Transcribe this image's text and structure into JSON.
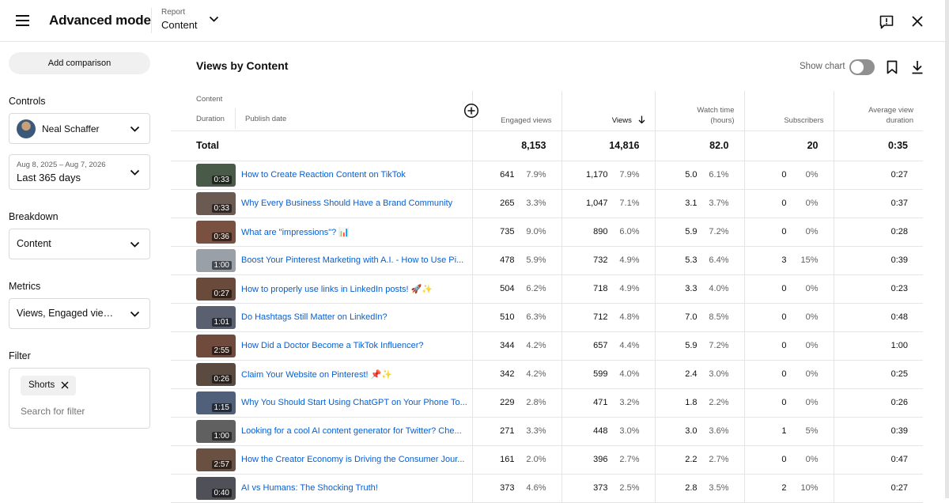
{
  "header": {
    "app_title": "Advanced mode",
    "report_label": "Report",
    "report_value": "Content"
  },
  "sidebar": {
    "add_comparison": "Add comparison",
    "controls_label": "Controls",
    "channel": "Neal Schaffer",
    "date_range_small": "Aug 8, 2025 – Aug 7, 2026",
    "date_range": "Last 365 days",
    "breakdown_label": "Breakdown",
    "breakdown_value": "Content",
    "metrics_label": "Metrics",
    "metrics_value": "Views, Engaged views, Watch time (hours), Subscribers, Average view duration",
    "filter_label": "Filter",
    "filter_chip": "Shorts",
    "filter_placeholder": "Search for filter"
  },
  "main": {
    "title": "Views by Content",
    "show_chart_label": "Show chart"
  },
  "table": {
    "headers": {
      "content": "Content",
      "duration": "Duration",
      "publish_date": "Publish date",
      "engaged_views": "Engaged views",
      "views": "Views",
      "watch_time_1": "Watch time",
      "watch_time_2": "(hours)",
      "subscribers": "Subscribers",
      "avg_dur_1": "Average view",
      "avg_dur_2": "duration"
    },
    "total": {
      "label": "Total",
      "engaged_views": "8,153",
      "views": "14,816",
      "watch_time": "82.0",
      "subscribers": "20",
      "avg_duration": "0:35"
    },
    "rows": [
      {
        "duration": "0:33",
        "title": "How to Create Reaction Content on TikTok",
        "engaged": "641",
        "engaged_pct": "7.9%",
        "views": "1,170",
        "views_pct": "7.9%",
        "watch": "5.0",
        "watch_pct": "6.1%",
        "subs": "0",
        "subs_pct": "0%",
        "avg": "0:27"
      },
      {
        "duration": "0:33",
        "title": "Why Every Business Should Have a Brand Community",
        "engaged": "265",
        "engaged_pct": "3.3%",
        "views": "1,047",
        "views_pct": "7.1%",
        "watch": "3.1",
        "watch_pct": "3.7%",
        "subs": "0",
        "subs_pct": "0%",
        "avg": "0:37"
      },
      {
        "duration": "0:36",
        "title": "What are \"impressions\"? 📊",
        "engaged": "735",
        "engaged_pct": "9.0%",
        "views": "890",
        "views_pct": "6.0%",
        "watch": "5.9",
        "watch_pct": "7.2%",
        "subs": "0",
        "subs_pct": "0%",
        "avg": "0:28"
      },
      {
        "duration": "1:00",
        "title": "Boost Your Pinterest Marketing with A.I. - How to Use Pi...",
        "engaged": "478",
        "engaged_pct": "5.9%",
        "views": "732",
        "views_pct": "4.9%",
        "watch": "5.3",
        "watch_pct": "6.4%",
        "subs": "3",
        "subs_pct": "15%",
        "avg": "0:39"
      },
      {
        "duration": "0:27",
        "title": "How to properly use links in LinkedIn posts! 🚀✨",
        "engaged": "504",
        "engaged_pct": "6.2%",
        "views": "718",
        "views_pct": "4.9%",
        "watch": "3.3",
        "watch_pct": "4.0%",
        "subs": "0",
        "subs_pct": "0%",
        "avg": "0:23"
      },
      {
        "duration": "1:01",
        "title": "Do Hashtags Still Matter on LinkedIn?",
        "engaged": "510",
        "engaged_pct": "6.3%",
        "views": "712",
        "views_pct": "4.8%",
        "watch": "7.0",
        "watch_pct": "8.5%",
        "subs": "0",
        "subs_pct": "0%",
        "avg": "0:48"
      },
      {
        "duration": "2:55",
        "title": "How Did a Doctor Become a TikTok Influencer?",
        "engaged": "344",
        "engaged_pct": "4.2%",
        "views": "657",
        "views_pct": "4.4%",
        "watch": "5.9",
        "watch_pct": "7.2%",
        "subs": "0",
        "subs_pct": "0%",
        "avg": "1:00"
      },
      {
        "duration": "0:26",
        "title": "Claim Your Website on Pinterest! 📌✨",
        "engaged": "342",
        "engaged_pct": "4.2%",
        "views": "599",
        "views_pct": "4.0%",
        "watch": "2.4",
        "watch_pct": "3.0%",
        "subs": "0",
        "subs_pct": "0%",
        "avg": "0:25"
      },
      {
        "duration": "1:15",
        "title": "Why You Should Start Using ChatGPT on Your Phone To...",
        "engaged": "229",
        "engaged_pct": "2.8%",
        "views": "471",
        "views_pct": "3.2%",
        "watch": "1.8",
        "watch_pct": "2.2%",
        "subs": "0",
        "subs_pct": "0%",
        "avg": "0:26"
      },
      {
        "duration": "1:00",
        "title": "Looking for a cool AI content generator for Twitter? Che...",
        "engaged": "271",
        "engaged_pct": "3.3%",
        "views": "448",
        "views_pct": "3.0%",
        "watch": "3.0",
        "watch_pct": "3.6%",
        "subs": "1",
        "subs_pct": "5%",
        "avg": "0:39"
      },
      {
        "duration": "2:57",
        "title": "How the Creator Economy is Driving the Consumer Jour...",
        "engaged": "161",
        "engaged_pct": "2.0%",
        "views": "396",
        "views_pct": "2.7%",
        "watch": "2.2",
        "watch_pct": "2.7%",
        "subs": "0",
        "subs_pct": "0%",
        "avg": "0:47"
      },
      {
        "duration": "0:40",
        "title": "AI vs Humans: The Shocking Truth!",
        "engaged": "373",
        "engaged_pct": "4.6%",
        "views": "373",
        "views_pct": "2.5%",
        "watch": "2.8",
        "watch_pct": "3.5%",
        "subs": "2",
        "subs_pct": "10%",
        "avg": "0:27"
      }
    ]
  },
  "icons": {
    "menu": "hamburger-menu-icon",
    "report_dropdown": "chevron-down-icon",
    "feedback": "feedback-icon",
    "close": "close-icon",
    "add_column": "add-circle-icon",
    "sort": "arrow-down-icon",
    "bookmark": "bookmark-icon",
    "download": "download-icon"
  },
  "colors": {
    "link": "#065fd4",
    "border": "#e5e5e5",
    "chip_bg": "#f0f0f0"
  }
}
